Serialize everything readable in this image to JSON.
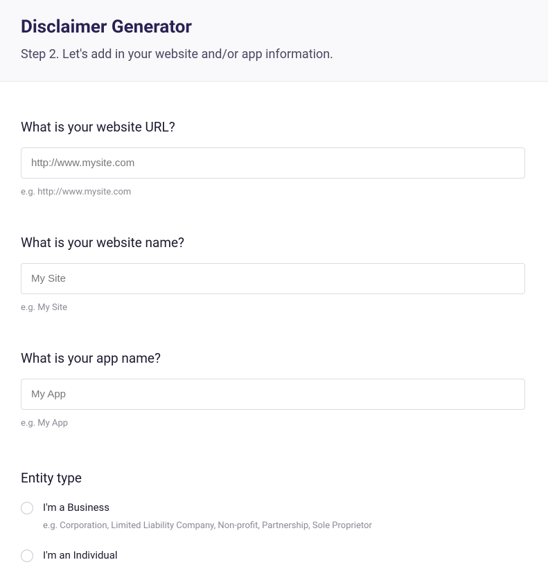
{
  "header": {
    "title": "Disclaimer Generator",
    "subtitle": "Step 2. Let's add in your website and/or app information."
  },
  "fields": {
    "website_url": {
      "label": "What is your website URL?",
      "placeholder": "http://www.mysite.com",
      "hint": "e.g. http://www.mysite.com"
    },
    "website_name": {
      "label": "What is your website name?",
      "placeholder": "My Site",
      "hint": "e.g. My Site"
    },
    "app_name": {
      "label": "What is your app name?",
      "placeholder": "My App",
      "hint": "e.g. My App"
    }
  },
  "entity": {
    "label": "Entity type",
    "options": [
      {
        "label": "I'm a Business",
        "hint": "e.g. Corporation, Limited Liability Company, Non-profit, Partnership, Sole Proprietor"
      },
      {
        "label": "I'm an Individual"
      }
    ]
  }
}
